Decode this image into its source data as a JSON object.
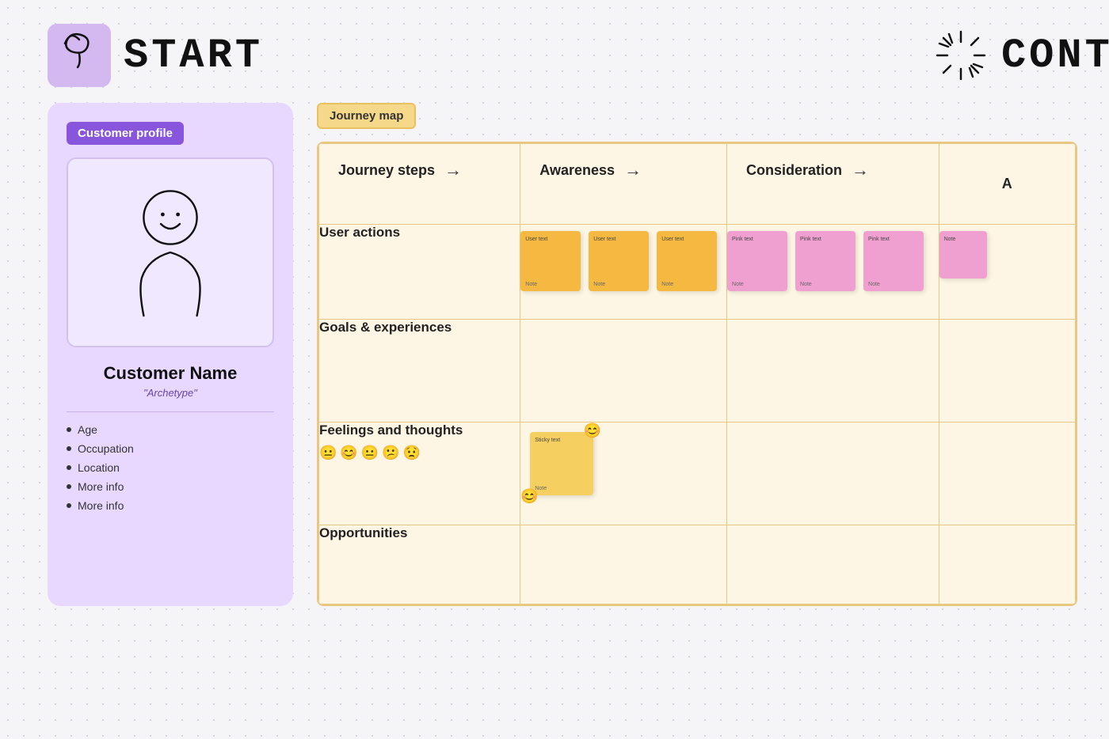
{
  "header": {
    "start_label": "START",
    "continue_label": "CONTI",
    "icon_start": "spiral",
    "icon_continue": "starburst"
  },
  "customer_profile": {
    "section_label": "Customer profile",
    "name": "Customer Name",
    "archetype": "\"Archetype\"",
    "info_items": [
      "Age",
      "Occupation",
      "Location",
      "More info",
      "More info"
    ]
  },
  "journey_map": {
    "section_label": "Journey map",
    "headers": {
      "steps": "Journey steps",
      "awareness": "Awareness",
      "consideration": "Consideration",
      "extra": "A"
    },
    "rows": {
      "user_actions": {
        "label": "User actions",
        "awareness_notes": [
          {
            "text": "User text",
            "bottom": "Note",
            "color": "orange"
          },
          {
            "text": "User text",
            "bottom": "Note",
            "color": "orange"
          },
          {
            "text": "User text",
            "bottom": "Note",
            "color": "orange"
          }
        ],
        "consideration_notes": [
          {
            "text": "Pink text",
            "bottom": "Note",
            "color": "pink"
          },
          {
            "text": "Pink text",
            "bottom": "Note",
            "color": "pink"
          },
          {
            "text": "Pink text",
            "bottom": "Note",
            "color": "pink"
          }
        ],
        "extra_notes": [
          {
            "text": "Note",
            "bottom": "",
            "color": "pink"
          }
        ]
      },
      "goals": {
        "label": "Goals & experiences"
      },
      "feelings": {
        "label": "Feelings and thoughts",
        "emojis": [
          "😐",
          "😊",
          "😐",
          "😕",
          "😟"
        ],
        "awareness_note": {
          "text": "Sticky text",
          "bottom": "Note",
          "color": "yellow"
        }
      },
      "opportunities": {
        "label": "Opportunities"
      }
    }
  }
}
